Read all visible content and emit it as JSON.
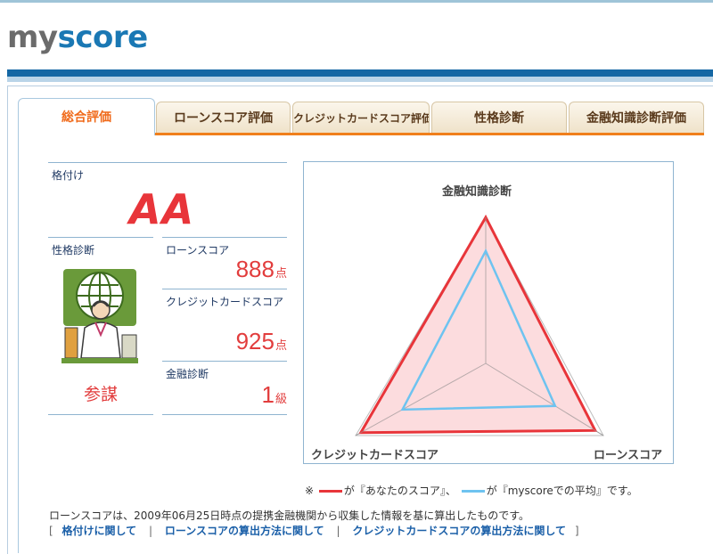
{
  "brand": {
    "logo_my": "my",
    "logo_score": "score"
  },
  "tabs": [
    {
      "label": "総合評価",
      "active": true
    },
    {
      "label": "ローンスコア評価",
      "active": false
    },
    {
      "label": "クレジットカードスコア評価",
      "active": false
    },
    {
      "label": "性格診断",
      "active": false
    },
    {
      "label": "金融知識診断評価",
      "active": false
    }
  ],
  "summary": {
    "rating_label": "格付け",
    "rating_value": "AA",
    "personality_label": "性格診断",
    "personality_value": "参謀",
    "loan_label": "ローンスコア",
    "loan_value": "888",
    "loan_unit": "点",
    "credit_label": "クレジットカードスコア",
    "credit_value": "925",
    "credit_unit": "点",
    "finance_label": "金融診断",
    "finance_value": "1",
    "finance_unit": "級"
  },
  "radar": {
    "axes": [
      "金融知識診断",
      "ローンスコア",
      "クレジットカードスコア"
    ],
    "yours": [
      1.0,
      0.93,
      0.96
    ],
    "average": [
      0.77,
      0.59,
      0.64
    ],
    "colors": {
      "yours_stroke": "#e8353a",
      "yours_fill": "#fbd0d3",
      "average_stroke": "#6ec3f0"
    }
  },
  "legend": {
    "prefix": "※",
    "yours_text": "が『あなたのスコア』、",
    "average_text": "が『myscoreでの平均』です。"
  },
  "footer": {
    "note": "ローンスコアは、2009年06月25日時点の提携金融機関から収集した情報を基に算出したものです。",
    "bracket_open": "[",
    "bracket_close": "]",
    "separator": "|",
    "links": [
      "格付けに関して",
      "ローンスコアの算出方法に関して",
      "クレジットカードスコアの算出方法に関して"
    ]
  }
}
